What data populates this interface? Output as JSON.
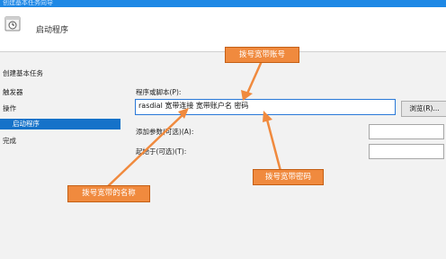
{
  "window": {
    "title": "创建基本任务向导"
  },
  "header": {
    "icon": "task-scheduler-icon",
    "title": "启动程序"
  },
  "sidebar": {
    "items": [
      {
        "label": "创建基本任务"
      },
      {
        "label": "触发器"
      },
      {
        "label": "操作"
      },
      {
        "label": "启动程序",
        "active": true
      },
      {
        "label": "完成"
      }
    ]
  },
  "form": {
    "program_label": "程序或脚本(P):",
    "program_value": "rasdial 宽带连接 宽带账户名 密码",
    "browse_label": "浏览(R)...",
    "args_label": "添加参数(可选)(A):",
    "args_value": "",
    "startin_label": "起始于(可选)(T):",
    "startin_value": ""
  },
  "annotations": {
    "account": "拨号宽带账号",
    "password": "拨号宽带密码",
    "name": "拨号宽带的名称",
    "color": "#f08a3e"
  }
}
